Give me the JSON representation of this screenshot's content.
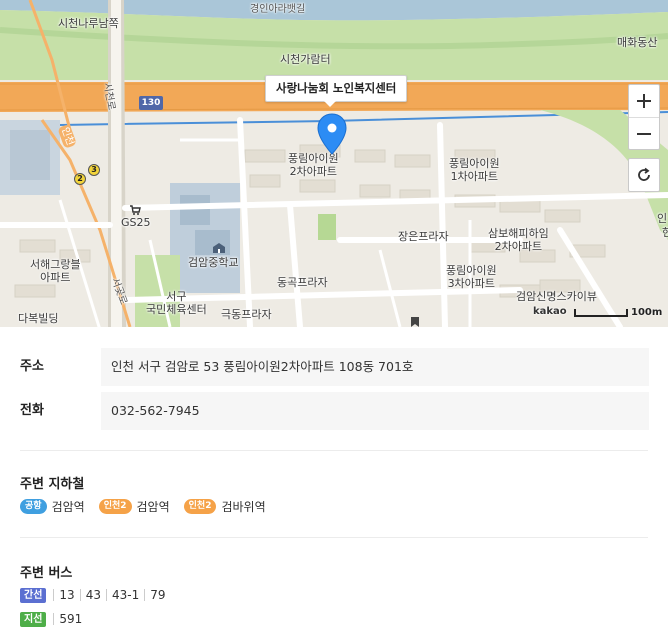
{
  "map": {
    "callout_label": "사랑나눔회 노인복지센터",
    "route_number": "130",
    "station_badges": [
      "2",
      "3"
    ],
    "labels": {
      "riverside_road": "경인아라뱃길",
      "sicheon_narubuk": "시천나루남쪽",
      "sicheon_garamteo": "시천가람터",
      "maehwa": "매화동산",
      "in_right": "인",
      "hyeon_right": "현",
      "pungrim2": "풍림아이원\n2차아파트",
      "pungrim1": "풍림아이원\n1차아파트",
      "sambo": "삼보해피하임\n2차아파트",
      "pungrim3": "풍림아이원\n3차아파트",
      "geomam_middle": "검암중학교",
      "gs25": "GS25",
      "seohae": "서해그랑블\n아파트",
      "seogu_sports": "서구\n국민체육센터",
      "dabok": "다복빌딩",
      "donggok": "동곡프라자",
      "geukdong": "극동프라자",
      "jangeun": "장은프라자",
      "geomam_sinmyeong": "검암신명스카이뷰",
      "sicheon_ro": "시천로",
      "seogot_ro": "서곶로",
      "incheon_station": "인천"
    },
    "kakao_logo": "kakao",
    "scale_label": "100m",
    "colors": {
      "water": "#aac6d8",
      "park": "#c6e0a8",
      "highway": "#f2a857",
      "road": "#ffffff",
      "block": "#e6e2d9",
      "school": "#bfcedb",
      "marker": "#2c8cf4",
      "rail": "#4a8fd8"
    }
  },
  "info": {
    "address_label": "주소",
    "address_value": "인천 서구 검암로 53 풍림아이원2차아파트 108동 701호",
    "phone_label": "전화",
    "phone_value": "032-562-7945",
    "subway_title": "주변 지하철",
    "subway": [
      {
        "line": "공항",
        "station": "검암역",
        "color": "#3f9fe0"
      },
      {
        "line": "인천2",
        "station": "검암역",
        "color": "#f5a248"
      },
      {
        "line": "인천2",
        "station": "검바위역",
        "color": "#f5a248"
      }
    ],
    "bus_title": "주변 버스",
    "bus": [
      {
        "type": "간선",
        "color": "#5b6fd1",
        "numbers": [
          "13",
          "43",
          "43-1",
          "79"
        ]
      },
      {
        "type": "지선",
        "color": "#4eae48",
        "numbers": [
          "591"
        ]
      }
    ]
  }
}
